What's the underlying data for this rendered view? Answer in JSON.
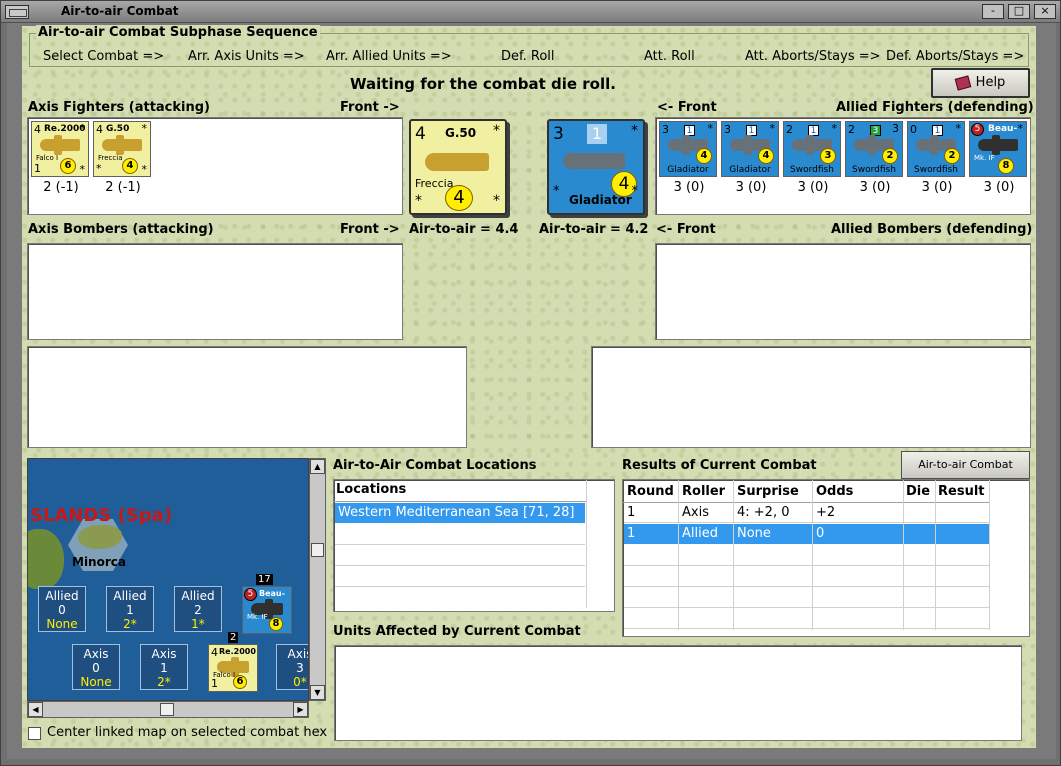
{
  "window": {
    "title": "Air-to-air Combat",
    "buttons": [
      "-",
      "□",
      "×"
    ]
  },
  "sequence": {
    "title": "Air-to-air Combat Subphase Sequence",
    "steps": [
      "Select Combat =>",
      "Arr. Axis Units =>",
      "Arr. Allied Units =>",
      "Def. Roll",
      "Att. Roll",
      "Att. Aborts/Stays =>",
      "Def. Aborts/Stays =>"
    ]
  },
  "status": "Waiting for the combat die roll.",
  "help": {
    "label": "Help"
  },
  "axis_fighters": {
    "title": "Axis Fighters (attacking)",
    "front": "Front ->",
    "units": [
      {
        "tl": "4",
        "name": "Re.2000",
        "tr": "*",
        "sub": "Falco I",
        "bl": "1",
        "circ": "6",
        "br": "*",
        "caption": "2 (-1)"
      },
      {
        "tl": "4",
        "name": "G.50",
        "tr": "*",
        "sub": "Freccia",
        "bl": "*",
        "circ": "4",
        "br": "*",
        "caption": "2 (-1)"
      }
    ]
  },
  "allied_fighters": {
    "title": "Allied Fighters (defending)",
    "front": "<- Front",
    "units": [
      {
        "tl": "3",
        "sq": "1",
        "tr": "*",
        "name": "Gladiator",
        "circ": "4",
        "caption": "3 (0)"
      },
      {
        "tl": "3",
        "sq": "1",
        "tr": "*",
        "name": "Gladiator",
        "circ": "4",
        "caption": "3 (0)"
      },
      {
        "tl": "2",
        "sq": "1",
        "tr": "*",
        "name": "Swordfish",
        "circ": "3",
        "caption": "3 (0)"
      },
      {
        "tl": "2",
        "sq": "3",
        "tr": "3",
        "name": "Swordfish",
        "circ": "2",
        "caption": "3 (0)"
      },
      {
        "tl": "0",
        "sq": "1",
        "tr": "*",
        "name": "Swordfish",
        "circ": "2",
        "caption": "3 (0)"
      },
      {
        "dot": "5",
        "name": "Beau-",
        "tr": "*",
        "circ": "8",
        "sub": "Mk. IF",
        "caption": "3 (0)"
      }
    ]
  },
  "selected_axis": {
    "tl": "4",
    "name": "G.50",
    "tr": "*",
    "sub": "Freccia",
    "bl": "*",
    "circ": "4",
    "br": "*",
    "rating": "Air-to-air = 4.4"
  },
  "selected_allied": {
    "tl": "3",
    "sq": "1",
    "tr": "*",
    "name": "Gladiator",
    "bl": "*",
    "circ": "4",
    "br": "*",
    "rating": "Air-to-air = 4.2"
  },
  "axis_bombers": {
    "title": "Axis Bombers (attacking)",
    "front": "Front ->"
  },
  "allied_bombers": {
    "title": "Allied Bombers (defending)",
    "front": "<- Front"
  },
  "map": {
    "region": "SLANDS (Spa)",
    "island": "Minorca",
    "allied_boxes": [
      {
        "label": "Allied",
        "num": "0",
        "value": "None"
      },
      {
        "label": "Allied",
        "num": "1",
        "value": "2*"
      },
      {
        "label": "Allied",
        "num": "2",
        "value": "1*"
      }
    ],
    "axis_boxes": [
      {
        "label": "Axis",
        "num": "0",
        "value": "None"
      },
      {
        "label": "Axis",
        "num": "1",
        "value": "2*"
      },
      {
        "label": "Axis",
        "num": "3",
        "value": "0*"
      }
    ],
    "stack_allied": {
      "count": "17",
      "dot": "5",
      "name": "Beau-",
      "sub": "Mk. IF",
      "circ": "8"
    },
    "stack_axis": {
      "count": "2",
      "tl": "4",
      "name": "Re.2000",
      "sub": "Falco I",
      "bl": "1",
      "circ": "6"
    },
    "center_checkbox": "Center linked map on selected combat hex"
  },
  "locations": {
    "title": "Air-to-Air Combat Locations",
    "header": "Locations",
    "rows": [
      "Western Mediterranean Sea [71, 28]"
    ]
  },
  "results": {
    "title": "Results of Current Combat",
    "chart_button": "Air-to-air Combat Chart",
    "columns": [
      "Round",
      "Roller",
      "Surprise",
      "Odds",
      "Die",
      "Result"
    ],
    "rows": [
      [
        "1",
        "Axis",
        "4: +2, 0",
        "+2",
        "",
        ""
      ],
      [
        "1",
        "Allied",
        "None",
        "0",
        "",
        ""
      ]
    ]
  },
  "units_affected": {
    "title": "Units Affected by Current Combat"
  },
  "colors": {
    "axis_counter": "#f0f0a0",
    "allied_counter": "#2a8ad0",
    "selection": "#3399ee",
    "background": "#d4ddb2"
  }
}
